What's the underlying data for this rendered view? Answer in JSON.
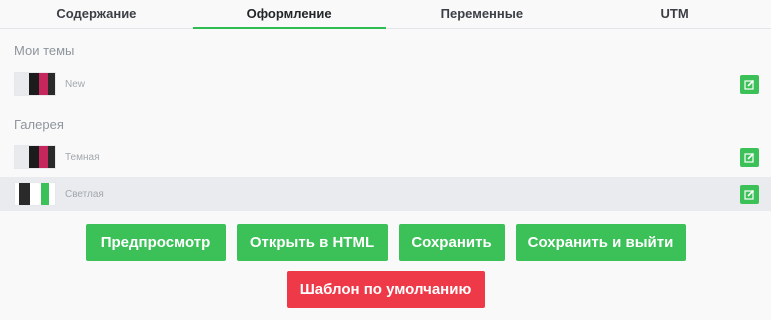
{
  "tabs": [
    {
      "label": "Содержание",
      "active": false
    },
    {
      "label": "Оформление",
      "active": true
    },
    {
      "label": "Переменные",
      "active": false
    },
    {
      "label": "UTM",
      "active": false
    }
  ],
  "my_themes": {
    "title": "Мои темы",
    "items": [
      {
        "name": "New",
        "swatch": [
          "#e8eaed",
          "#1c1c1c",
          "#c5265b",
          "#2a2a2a"
        ]
      }
    ]
  },
  "gallery": {
    "title": "Галерея",
    "items": [
      {
        "name": "Темная",
        "swatch": [
          "#e8eaed",
          "#1c1c1c",
          "#c5265b",
          "#2a2a2a"
        ],
        "selected": false
      },
      {
        "name": "Светлая",
        "swatch": [
          "#ffffff",
          "#2a2a2a",
          "#ffffff",
          "#3cc159"
        ],
        "selected": true
      }
    ]
  },
  "actions": {
    "preview": "Предпросмотр",
    "open_html": "Открыть в HTML",
    "save": "Сохранить",
    "save_exit": "Сохранить и выйти",
    "default_template": "Шаблон по умолчанию"
  },
  "colors": {
    "accent": "#3cc159",
    "danger": "#ee3a48"
  },
  "icons": {
    "edit": "edit-icon"
  }
}
